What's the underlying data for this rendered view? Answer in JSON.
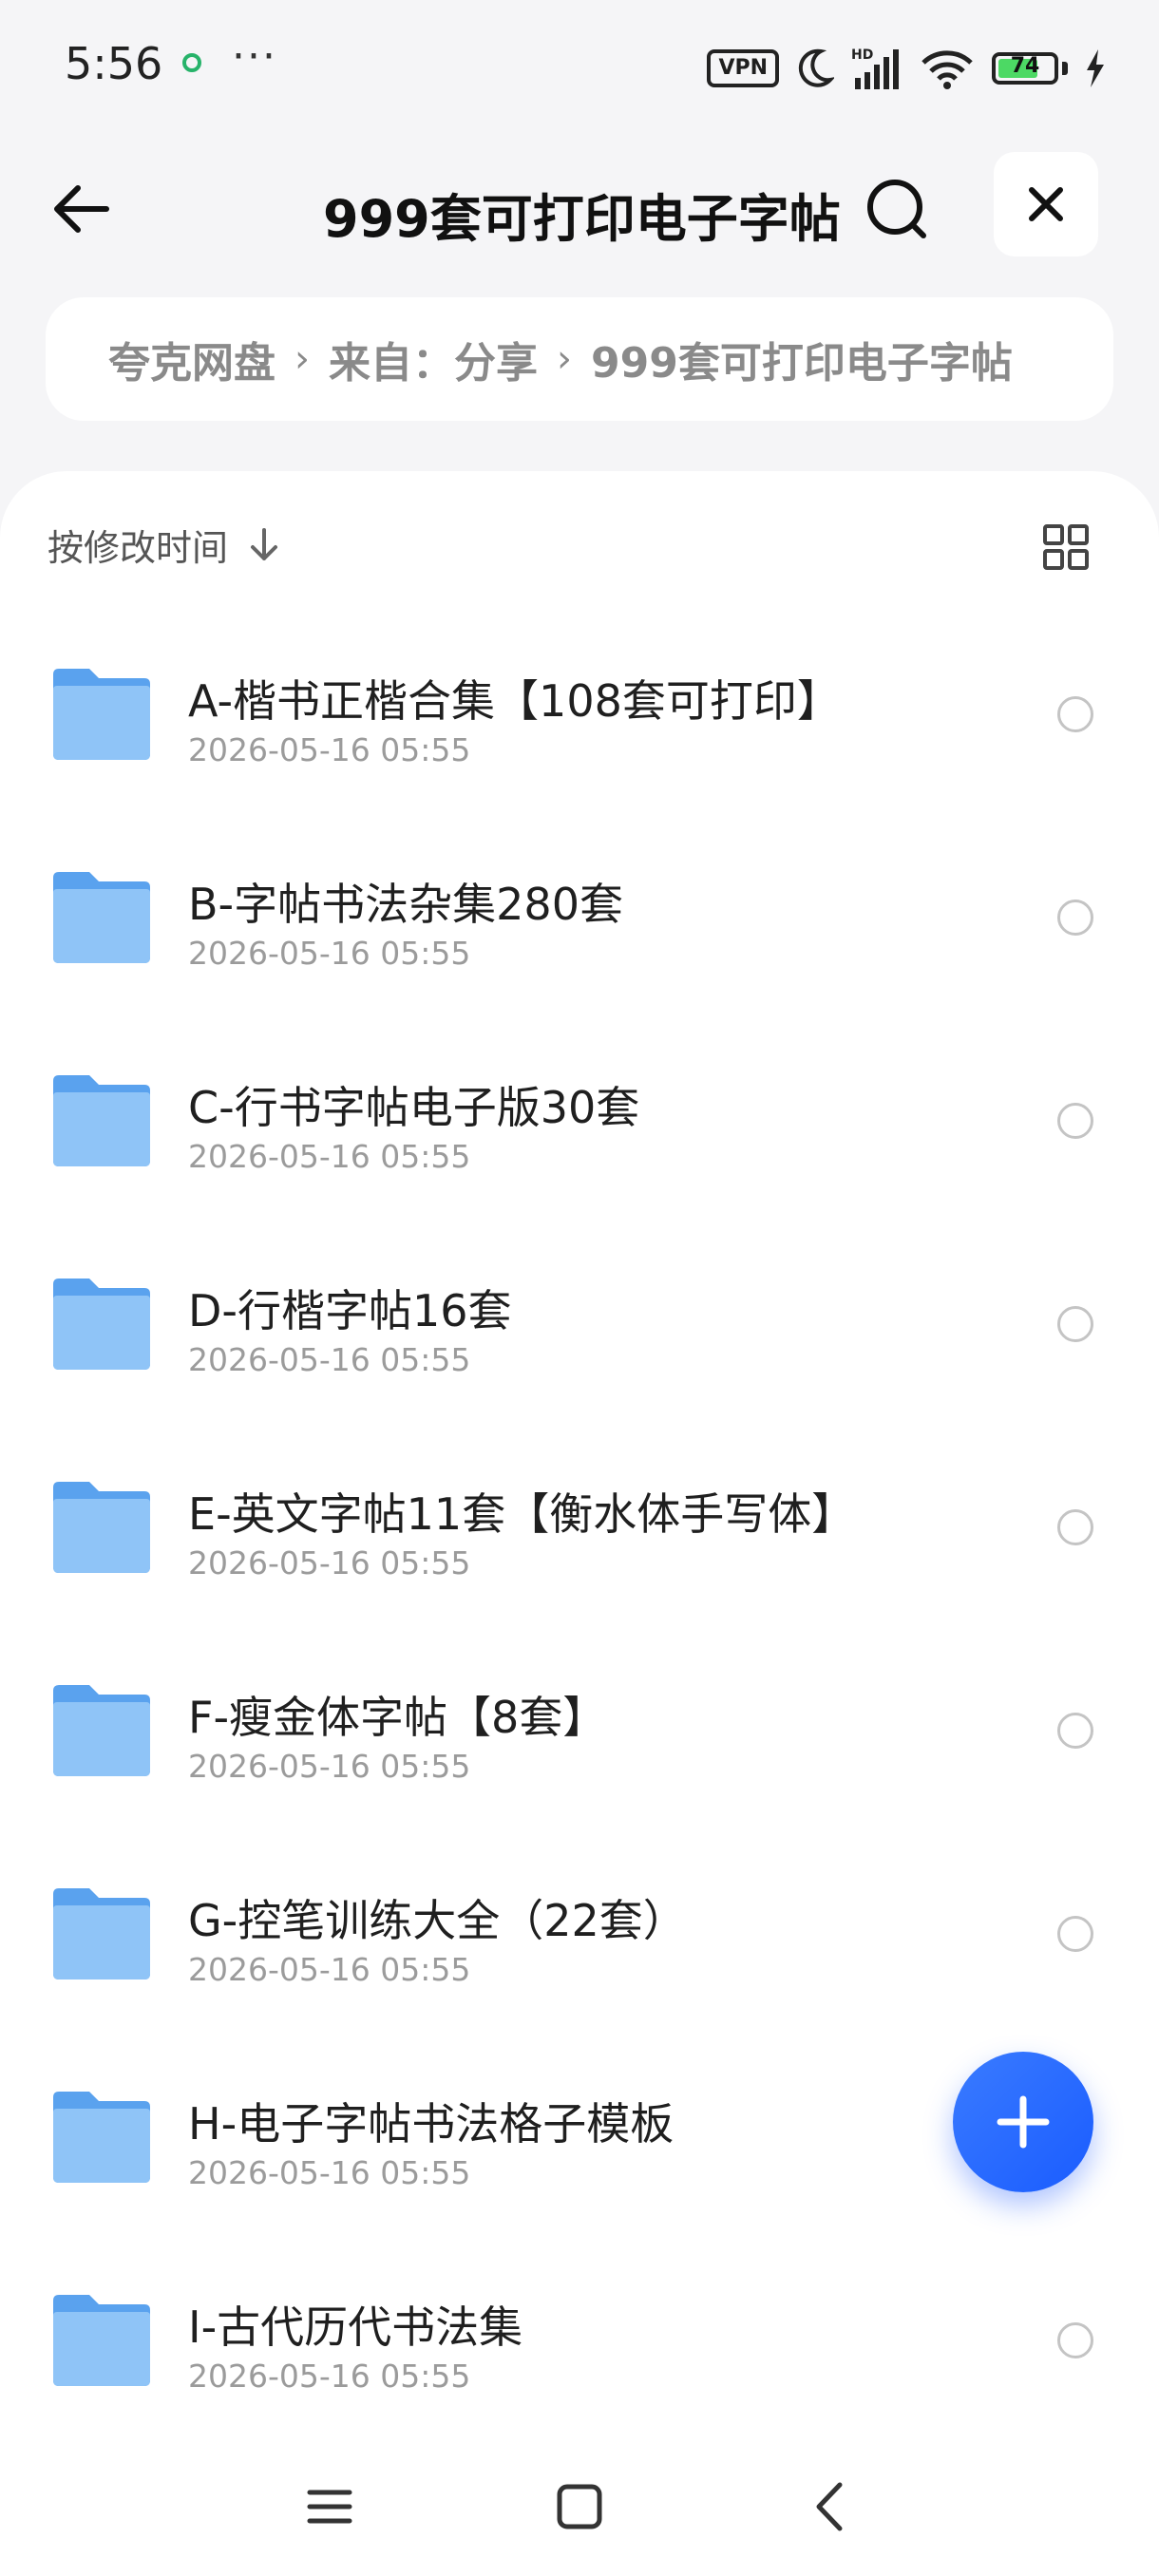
{
  "status_bar": {
    "time": "5:56",
    "more": "···",
    "vpn": "VPN",
    "battery": "74",
    "battery_level": 0.74,
    "icons": [
      "notification-icon",
      "moon-icon",
      "signal-icon",
      "wifi-icon",
      "charging-icon"
    ]
  },
  "header": {
    "title": "999套可打印电子字帖",
    "back_icon": "arrow-left-icon",
    "search_icon": "search-icon",
    "close_icon": "close-icon"
  },
  "breadcrumb": {
    "items": [
      "夸克网盘",
      "来自：分享",
      "999套可打印电子字帖"
    ],
    "separator": "›"
  },
  "toolbar": {
    "sort_label": "按修改时间",
    "sort_icon": "arrow-down-icon",
    "view_icon": "grid-view-icon"
  },
  "files": [
    {
      "name": "A-楷书正楷合集【108套可打印】",
      "date": "2026-05-16 05:55"
    },
    {
      "name": "B-字帖书法杂集280套",
      "date": "2026-05-16 05:55"
    },
    {
      "name": "C-行书字帖电子版30套",
      "date": "2026-05-16 05:55"
    },
    {
      "name": "D-行楷字帖16套",
      "date": "2026-05-16 05:55"
    },
    {
      "name": "E-英文字帖11套【衡水体手写体】",
      "date": "2026-05-16 05:55"
    },
    {
      "name": "F-瘦金体字帖【8套】",
      "date": "2026-05-16 05:55"
    },
    {
      "name": "G-控笔训练大全（22套）",
      "date": "2026-05-16 05:55"
    },
    {
      "name": "H-电子字帖书法格子模板",
      "date": "2026-05-16 05:55"
    },
    {
      "name": "I-古代历代书法集",
      "date": "2026-05-16 05:55"
    }
  ],
  "fab": {
    "icon": "plus-icon"
  },
  "colors": {
    "accent": "#1a5cff",
    "folder": "#6fb2f5",
    "background": "#f5f5f7"
  }
}
